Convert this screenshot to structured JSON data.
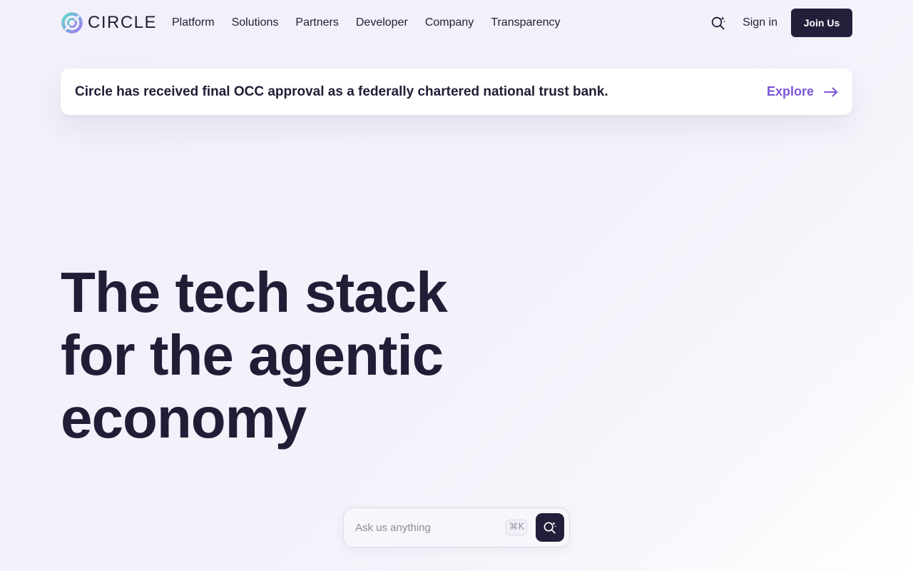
{
  "header": {
    "logo_text": "CIRCLE",
    "nav": [
      {
        "label": "Platform"
      },
      {
        "label": "Solutions"
      },
      {
        "label": "Partners"
      },
      {
        "label": "Developer"
      },
      {
        "label": "Company"
      },
      {
        "label": "Transparency"
      }
    ],
    "search_icon": "sparkle-search-icon",
    "sign_in_label": "Sign in",
    "join_label": "Join Us"
  },
  "banner": {
    "text": "Circle has received final OCC approval as a federally chartered national trust bank.",
    "link_label": "Explore",
    "link_icon": "arrow-right-icon"
  },
  "hero": {
    "title_lines": [
      "The tech stack",
      "for the agentic",
      "economy"
    ]
  },
  "ask": {
    "placeholder": "Ask us anything",
    "shortcut": "⌘K",
    "submit_icon": "sparkle-search-icon"
  },
  "colors": {
    "primary_dark": "#231e3a",
    "accent_purple": "#7b56d8",
    "logo_teal": "#5fd0c8",
    "logo_purple": "#8c7be8"
  }
}
